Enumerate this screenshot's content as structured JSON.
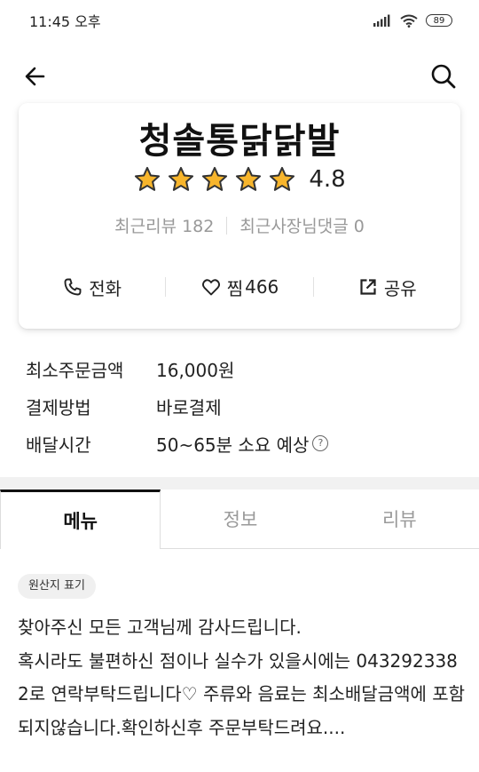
{
  "status_bar": {
    "time": "11:45 오후",
    "battery": "89"
  },
  "store": {
    "name": "청솔통닭닭발",
    "rating": "4.8",
    "star_count": 5,
    "recent_reviews": "최근리뷰 182",
    "owner_replies": "최근사장님댓글 0"
  },
  "actions": {
    "call_label": "전화",
    "favorite_label": "찜",
    "favorite_count": "466",
    "share_label": "공유"
  },
  "info": {
    "min_order_label": "최소주문금액",
    "min_order_value": "16,000원",
    "payment_label": "결제방법",
    "payment_value": "바로결제",
    "delivery_label": "배달시간",
    "delivery_value": "50~65분 소요 예상",
    "help_icon": "?"
  },
  "tabs": {
    "menu": "메뉴",
    "info": "정보",
    "review": "리뷰"
  },
  "origin_chip": "원산지 표기",
  "notice_text": "찾아주신 모든 고객님께 감사드립니다.\n혹시라도 불편하신 점이나 실수가 있을시에는 0432923382로 연락부탁드립니다♡ 주류와 음료는 최소배달금액에 포함되지않습니다.확인하신후 주문부탁드려요....",
  "colors": {
    "star": "#F7B52C",
    "star_stroke": "#333333",
    "text_muted": "#999999"
  },
  "icons": [
    "back-arrow-icon",
    "search-icon",
    "star-icon",
    "phone-icon",
    "heart-icon",
    "share-icon",
    "signal-icon",
    "wifi-icon",
    "battery-icon",
    "help-circle-icon"
  ]
}
